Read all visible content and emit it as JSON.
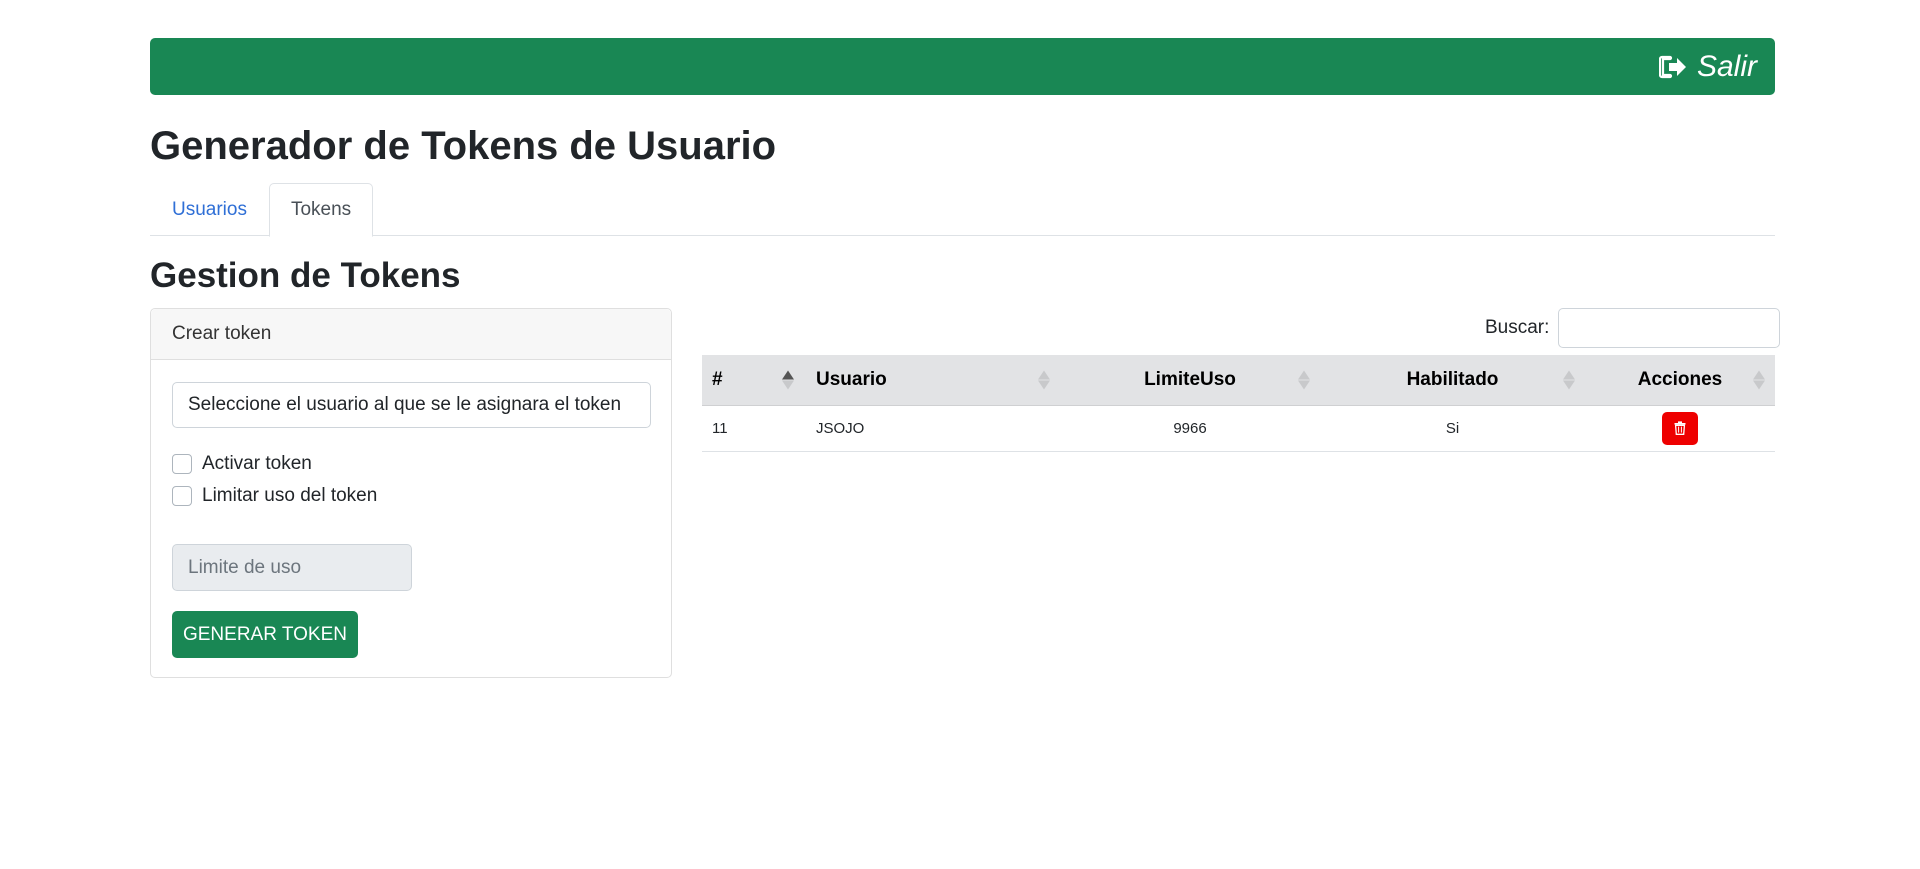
{
  "header": {
    "logout_label": "Salir",
    "accent": "#198754"
  },
  "page": {
    "title": "Generador de Tokens de Usuario"
  },
  "tabs": [
    {
      "label": "Usuarios",
      "active": false
    },
    {
      "label": "Tokens",
      "active": true
    }
  ],
  "section": {
    "title": "Gestion de Tokens"
  },
  "form": {
    "card_title": "Crear token",
    "user_select_value": "Seleccione el usuario al que se le asignara el token",
    "activate_label": "Activar token",
    "limit_label": "Limitar uso del token",
    "limit_placeholder": "Limite de uso",
    "generate_label": "GENERAR TOKEN"
  },
  "search": {
    "label": "Buscar:",
    "value": ""
  },
  "table": {
    "columns": [
      "#",
      "Usuario",
      "LimiteUso",
      "Habilitado",
      "Acciones"
    ],
    "rows": [
      {
        "id": "11",
        "usuario": "JSOJO",
        "limite": "9966",
        "habilitado": "Si",
        "action_icon": "trash-icon"
      }
    ],
    "delete_color": "#ee0000"
  }
}
